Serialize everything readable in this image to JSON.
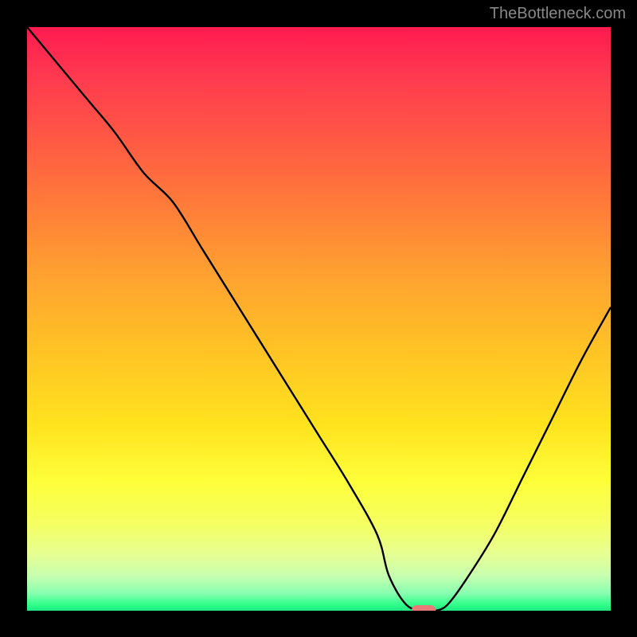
{
  "attribution": "TheBottleneck.com",
  "chart_data": {
    "type": "line",
    "title": "",
    "xlabel": "",
    "ylabel": "",
    "xlim": [
      0,
      100
    ],
    "ylim": [
      0,
      100
    ],
    "x": [
      0,
      5,
      10,
      15,
      20,
      25,
      30,
      35,
      40,
      45,
      50,
      55,
      60,
      62,
      65,
      68,
      70,
      72,
      75,
      80,
      85,
      90,
      95,
      100
    ],
    "values": [
      100,
      94,
      88,
      82,
      75,
      70,
      62,
      54,
      46,
      38,
      30,
      22,
      13,
      6,
      1,
      0,
      0,
      1,
      5,
      13,
      23,
      33,
      43,
      52
    ],
    "marker": {
      "x": 68,
      "y": 0,
      "color": "#e87a7a"
    },
    "background": "vertical-gradient red-yellow-green",
    "annotations": []
  }
}
